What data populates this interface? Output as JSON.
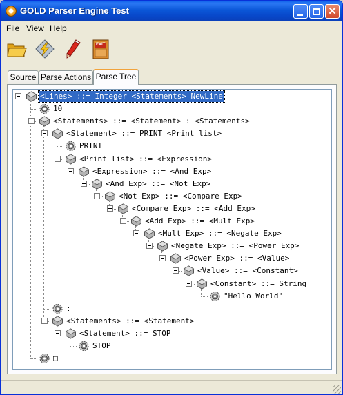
{
  "window": {
    "title": "GOLD Parser Engine Test"
  },
  "menu": [
    "File",
    "View",
    "Help"
  ],
  "toolbar": [
    {
      "name": "open-folder",
      "icon": "folder-icon"
    },
    {
      "name": "parse",
      "icon": "lightning-icon"
    },
    {
      "name": "edit",
      "icon": "pencil-icon"
    },
    {
      "name": "exit",
      "icon": "exit-door-icon",
      "label": "EXIT"
    }
  ],
  "tabs": [
    {
      "label": "Source",
      "active": false
    },
    {
      "label": "Parse Actions",
      "active": false
    },
    {
      "label": "Parse Tree",
      "active": true
    }
  ],
  "tree": [
    {
      "depth": 0,
      "type": "rule",
      "text": "<Lines> ::= Integer <Statements> NewLine",
      "selected": true,
      "expanded": true
    },
    {
      "depth": 1,
      "type": "token",
      "text": "10"
    },
    {
      "depth": 1,
      "type": "rule",
      "text": "<Statements> ::= <Statement> : <Statements>",
      "expanded": true
    },
    {
      "depth": 2,
      "type": "rule",
      "text": "<Statement> ::= PRINT <Print list>",
      "expanded": true
    },
    {
      "depth": 3,
      "type": "token",
      "text": "PRINT"
    },
    {
      "depth": 3,
      "type": "rule",
      "text": "<Print list> ::= <Expression>",
      "expanded": true
    },
    {
      "depth": 4,
      "type": "rule",
      "text": "<Expression> ::= <And Exp>",
      "expanded": true
    },
    {
      "depth": 5,
      "type": "rule",
      "text": "<And Exp> ::= <Not Exp>",
      "expanded": true
    },
    {
      "depth": 6,
      "type": "rule",
      "text": "<Not Exp> ::= <Compare Exp>",
      "expanded": true
    },
    {
      "depth": 7,
      "type": "rule",
      "text": "<Compare Exp> ::= <Add Exp>",
      "expanded": true
    },
    {
      "depth": 8,
      "type": "rule",
      "text": "<Add Exp> ::= <Mult Exp>",
      "expanded": true
    },
    {
      "depth": 9,
      "type": "rule",
      "text": "<Mult Exp> ::= <Negate Exp>",
      "expanded": true
    },
    {
      "depth": 10,
      "type": "rule",
      "text": "<Negate Exp> ::= <Power Exp>",
      "expanded": true
    },
    {
      "depth": 11,
      "type": "rule",
      "text": "<Power Exp> ::= <Value>",
      "expanded": true
    },
    {
      "depth": 12,
      "type": "rule",
      "text": "<Value> ::= <Constant>",
      "expanded": true
    },
    {
      "depth": 13,
      "type": "rule",
      "text": "<Constant> ::= String",
      "expanded": true
    },
    {
      "depth": 14,
      "type": "token",
      "text": "\"Hello World\""
    },
    {
      "depth": 2,
      "type": "token",
      "text": ":"
    },
    {
      "depth": 2,
      "type": "rule",
      "text": "<Statements> ::= <Statement>",
      "expanded": true
    },
    {
      "depth": 3,
      "type": "rule",
      "text": "<Statement> ::= STOP",
      "expanded": true
    },
    {
      "depth": 4,
      "type": "token",
      "text": "STOP"
    },
    {
      "depth": 1,
      "type": "token",
      "text": "□"
    }
  ]
}
